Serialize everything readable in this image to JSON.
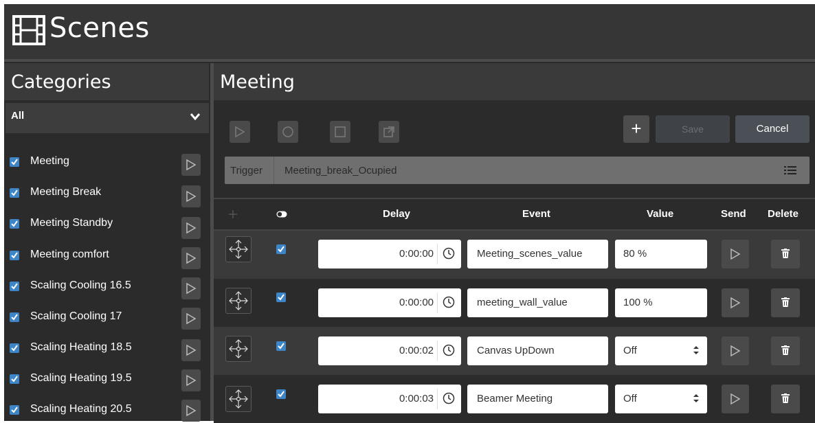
{
  "app": {
    "title": "Scenes",
    "icon": "film-icon"
  },
  "categories": {
    "title": "Categories",
    "filter": {
      "selected": "All"
    },
    "items": [
      {
        "label": "Meeting",
        "checked": true
      },
      {
        "label": "Meeting Break",
        "checked": true
      },
      {
        "label": "Meeting Standby",
        "checked": true
      },
      {
        "label": "Meeting comfort",
        "checked": true
      },
      {
        "label": "Scaling Cooling 16.5",
        "checked": true
      },
      {
        "label": "Scaling Cooling 17",
        "checked": true
      },
      {
        "label": "Scaling Heating 18.5",
        "checked": true
      },
      {
        "label": "Scaling Heating 19.5",
        "checked": true
      },
      {
        "label": "Scaling Heating 20.5",
        "checked": true
      }
    ]
  },
  "scene": {
    "title": "Meeting",
    "toolbar": {
      "play_icon": "play-icon",
      "record_icon": "record-icon",
      "stop_icon": "stop-icon",
      "export_icon": "export-icon",
      "add_label": "+",
      "save_label": "Save",
      "cancel_label": "Cancel"
    },
    "trigger": {
      "label": "Trigger",
      "value": "Meeting_break_Ocupied"
    },
    "table": {
      "headers": {
        "drag": "",
        "enabled": "",
        "delay": "Delay",
        "event": "Event",
        "value": "Value",
        "send": "Send",
        "delete": "Delete"
      },
      "rows": [
        {
          "delay": "0:00:00",
          "event": "Meeting_scenes_value",
          "value": "80 %",
          "value_type": "text",
          "enabled": true
        },
        {
          "delay": "0:00:00",
          "event": "meeting_wall_value",
          "value": "100 %",
          "value_type": "text",
          "enabled": true
        },
        {
          "delay": "0:00:02",
          "event": "Canvas UpDown",
          "value": "Off",
          "value_type": "select",
          "enabled": true
        },
        {
          "delay": "0:00:03",
          "event": "Beamer Meeting",
          "value": "Off",
          "value_type": "select",
          "enabled": true
        }
      ]
    }
  },
  "colors": {
    "accent": "#3d85c6",
    "background": "#2b2b2b",
    "panel_header": "#3a3a3a"
  }
}
